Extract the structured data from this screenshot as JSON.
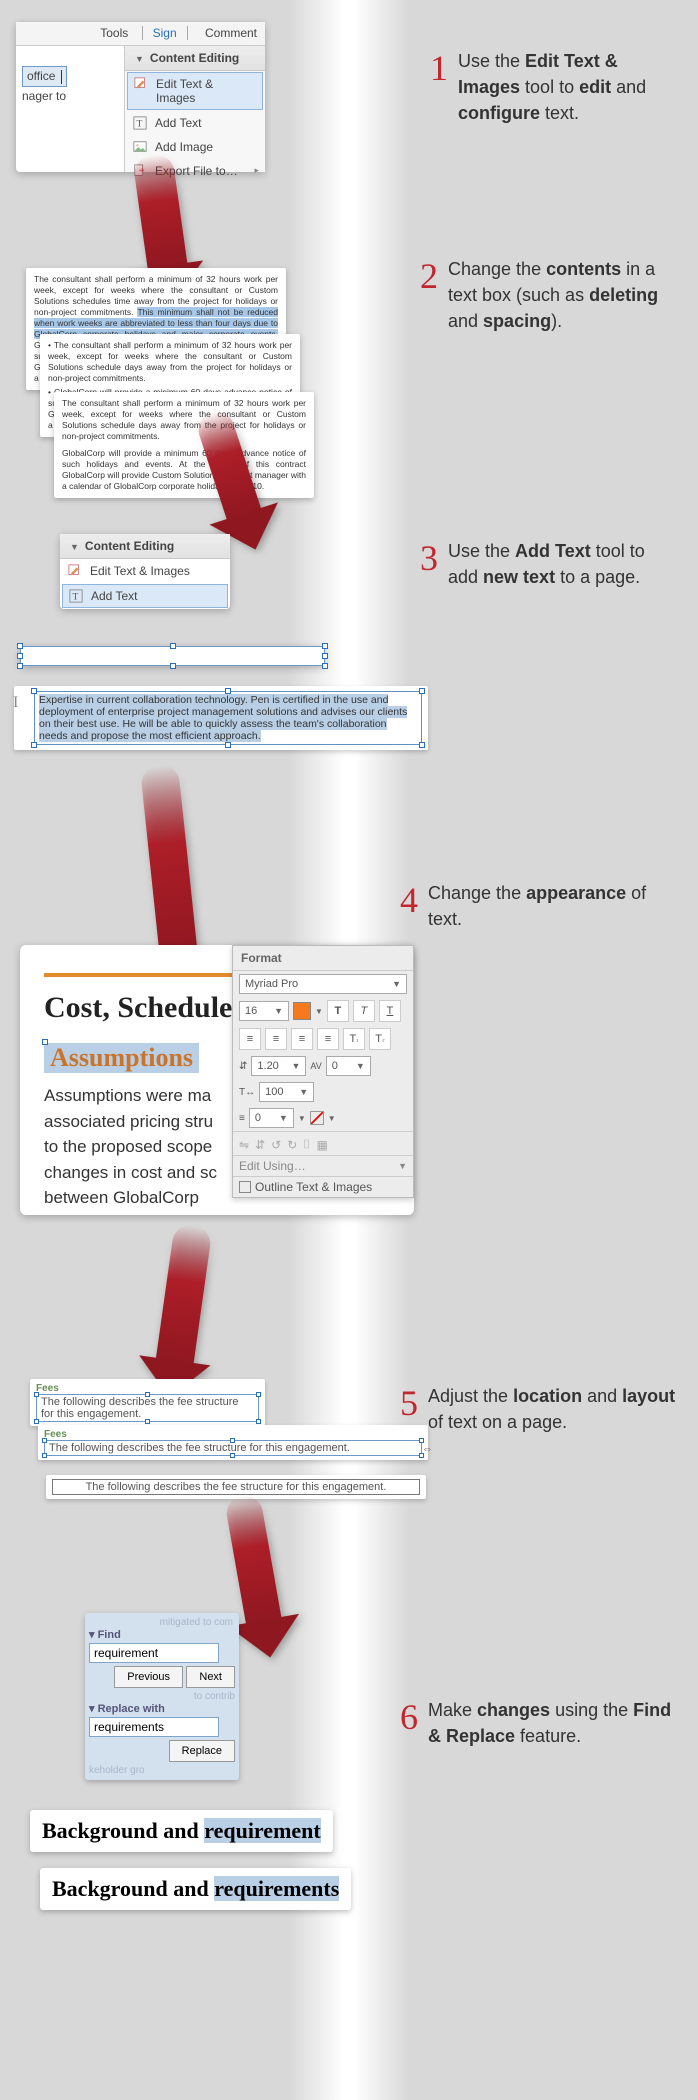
{
  "captions": {
    "c1a": "Use the ",
    "c1b": "Edit Text & Images",
    "c1c": " tool to ",
    "c1d": "edit",
    "c1e": " and ",
    "c1f": "configure",
    "c1g": " text.",
    "c2a": "Change the ",
    "c2b": "contents",
    "c2c": " in a text box (such as ",
    "c2d": "deleting",
    "c2e": " and ",
    "c2f": "spacing",
    "c2g": ").",
    "c3a": "Use the ",
    "c3b": "Add Text",
    "c3c": " tool to add ",
    "c3d": "new text",
    "c3e": " to a page.",
    "c4a": "Change the ",
    "c4b": "appearance",
    "c4c": " of text.",
    "c5a": "Adjust the ",
    "c5b": "location",
    "c5c": " and ",
    "c5d": "layout",
    "c5e": " of text on a page.",
    "c6a": "Make ",
    "c6b": "changes",
    "c6c": " using the ",
    "c6d": "Find & Replace",
    "c6e": " feature."
  },
  "nums": {
    "n1": "1",
    "n2": "2",
    "n3": "3",
    "n4": "4",
    "n5": "5",
    "n6": "6"
  },
  "topbar": {
    "tools": "Tools",
    "sign": "Sign",
    "comment": "Comment"
  },
  "contentEditing": {
    "title": "Content Editing",
    "editTextImages": "Edit Text & Images",
    "addText": "Add Text",
    "addImage": "Add Image",
    "exportFile": "Export File to…"
  },
  "snippet": {
    "office": "office",
    "nager": "nager to"
  },
  "para": {
    "l1": "The consultant shall perform a minimum of 32 hours work per week, except for weeks where the consultant or Custom Solutions schedules time away from the project for holidays or non-project commitments. ",
    "hl": "This minimum shall not be reduced when work weeks are abbreviated to less than four days due to GlobalCorp corporate holidays and major corporate events.",
    "l2": " GlobalCorp will provide a minimum 60 days advance notice of such holidays and events. At the outset of this contract GlobalCorp will provide Custom Solution's account manager with a calendar of GlobalCorp corporate holidays for 2010.",
    "l3": "The consultant shall perform a minimum of 32 hours work per week, except for weeks where the consultant or Custom Solutions schedule days away from the project for holidays or non-project commitments.",
    "l4": "GlobalCorp will provide a minimum 60 days advance notice of such holidays and events. At the outset of this contract GlobalCorp will provide Custom Solution's account manager with a calendar of GlobalCorp corporate holidays for 2010."
  },
  "expertise": {
    "text": "Expertise in current collaboration technology.  Pen is certified in the use and deployment of enterprise project management solutions and advises our clients on their best use. He will be able to quickly assess the team's collaboration needs and propose the most efficient approach."
  },
  "doc": {
    "costHeading": "Cost, Schedule",
    "assumptions": "Assumptions",
    "body1": "Assumptions were ma",
    "body2": "associated pricing stru",
    "body3": "to the proposed scope",
    "body4": "changes in cost and sc",
    "body5": "between GlobalCorp"
  },
  "format": {
    "title": "Format",
    "font": "Myriad Pro",
    "size": "16",
    "spacing": "1.20",
    "av": "0",
    "scale": "100",
    "stroke": "0",
    "editUsing": "Edit Using…",
    "outline": "Outline Text & Images",
    "btns": {
      "T": "T",
      "Ti": "T",
      "Tu": "T",
      "Ts": "T"
    },
    "align": {
      "l": "≡",
      "c": "≡",
      "r": "≡",
      "j": "≡"
    },
    "tsuper": "T",
    "tsub": "T",
    "horiz": "↔"
  },
  "fees": {
    "title": "Fees",
    "line": "The following describes the fee structure for this engagement."
  },
  "find": {
    "findLabel": "Find",
    "findVal": "requirement",
    "prev": "Previous",
    "next": "Next",
    "replaceLabel": "Replace with",
    "replaceVal": "requirements",
    "replaceBtn": "Replace",
    "bg_a": "Background and ",
    "bg_b1": "requirement",
    "bg_b2": "requirements",
    "ghost1": "mitigated to com",
    "ghost2": "to contrib",
    "ghost3": "keholder gro"
  }
}
